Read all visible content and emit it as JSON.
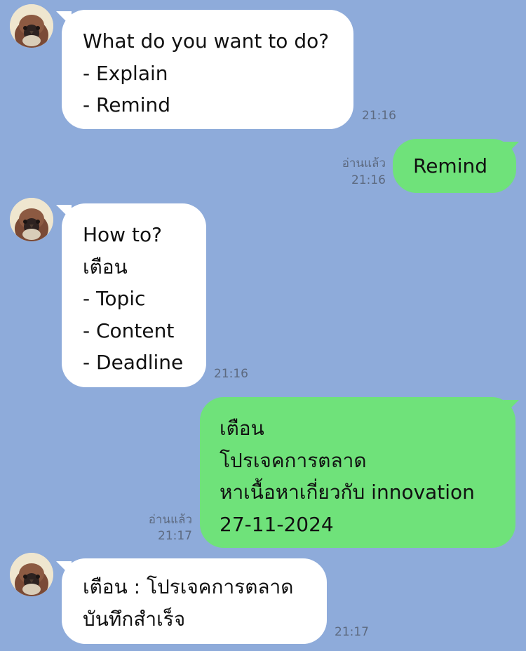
{
  "messages": [
    {
      "direction": "incoming",
      "lines": [
        "What do you want to do?",
        "- Explain",
        "- Remind"
      ],
      "time": "21:16"
    },
    {
      "direction": "outgoing",
      "lines": [
        "Remind"
      ],
      "read": "อ่านแล้ว",
      "time": "21:16"
    },
    {
      "direction": "incoming",
      "lines": [
        "How to?",
        "เตือน",
        "- Topic",
        "- Content",
        "- Deadline"
      ],
      "time": "21:16"
    },
    {
      "direction": "outgoing",
      "lines": [
        "เตือน",
        "โปรเจคการตลาด",
        "หาเนื้อหาเกี่ยวกับ innovation",
        "27-11-2024"
      ],
      "read": "อ่านแล้ว",
      "time": "21:17"
    },
    {
      "direction": "incoming",
      "lines": [
        "เตือน : โปรเจคการตลาด",
        "บันทึกสำเร็จ"
      ],
      "time": "21:17"
    }
  ],
  "colors": {
    "background": "#8eabda",
    "incoming_bubble": "#ffffff",
    "outgoing_bubble": "#6fe27a",
    "meta_text": "#5d6a80"
  },
  "icons": {
    "avatar": "sparrow-avatar-icon"
  }
}
